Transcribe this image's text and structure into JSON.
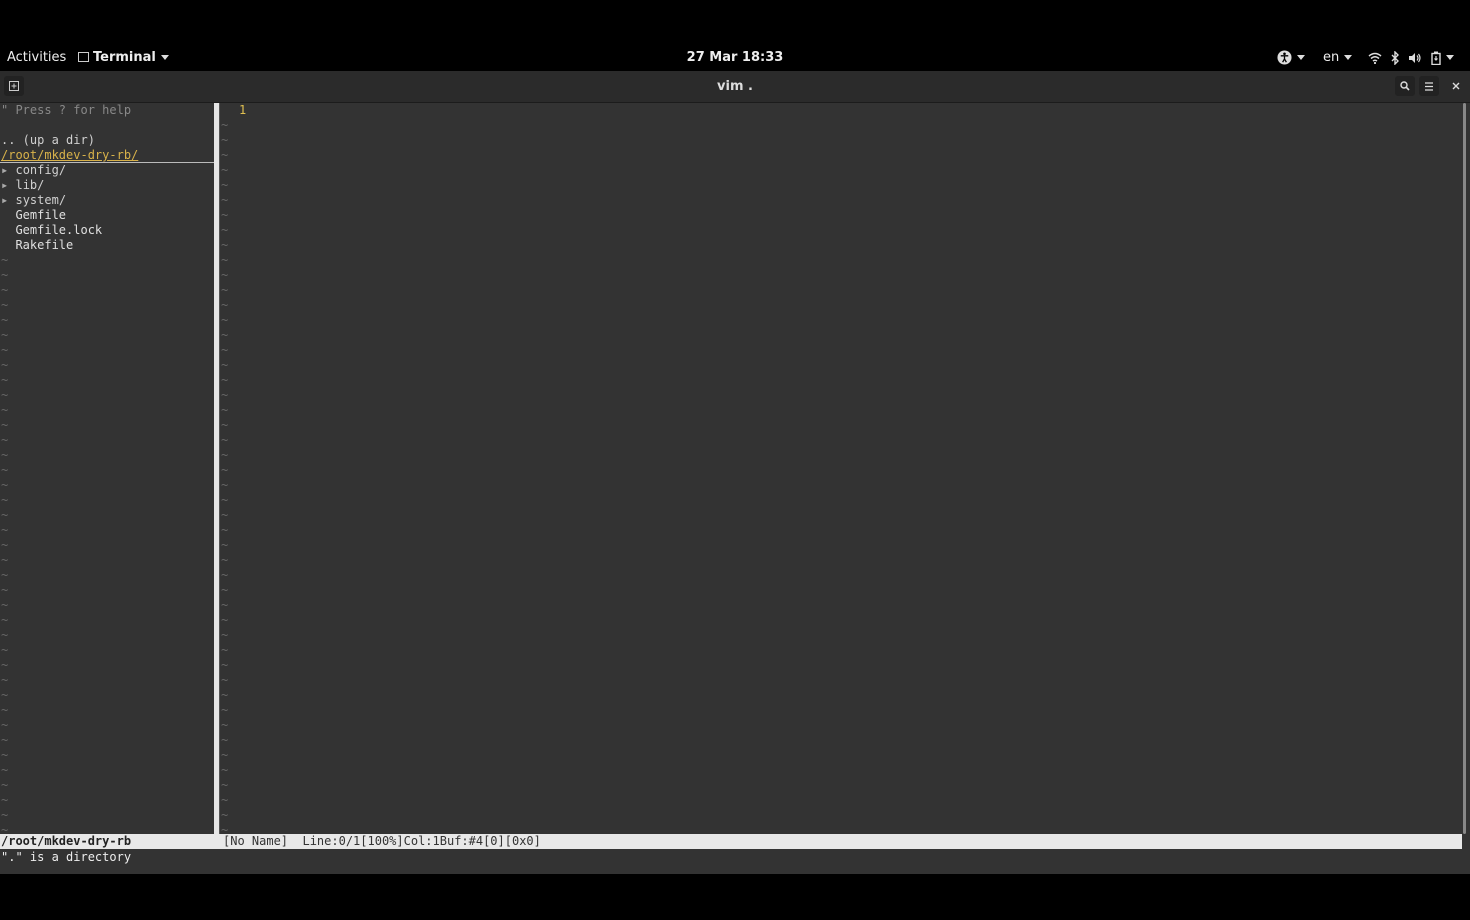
{
  "topbar": {
    "activities": "Activities",
    "app_name": "Terminal",
    "datetime": "27 Mar  18:33",
    "language": "en"
  },
  "window": {
    "title": "vim ."
  },
  "tree": {
    "help": "\" Press ? for help",
    "up_dir": ".. (up a dir)",
    "root_path": "/root/mkdev-dry-rb/",
    "items": [
      {
        "arrow": "▸",
        "name": "config/"
      },
      {
        "arrow": "▸",
        "name": "lib/"
      },
      {
        "arrow": "▸",
        "name": "system/"
      },
      {
        "arrow": "",
        "name": "Gemfile"
      },
      {
        "arrow": "",
        "name": "Gemfile.lock"
      },
      {
        "arrow": "",
        "name": "Rakefile"
      }
    ],
    "filler": "~"
  },
  "editor": {
    "line_number": "1",
    "filler": "~"
  },
  "statusline": {
    "left": "/root/mkdev-dry-rb",
    "right": "[No Name]  Line:0/1[100%]Col:1Buf:#4[0][0x0]"
  },
  "cmdline": {
    "message": "\".\" is a directory"
  },
  "colors": {
    "path_accent": "#d8b24a",
    "background": "#333333",
    "statusline": "#e8e8e8"
  }
}
